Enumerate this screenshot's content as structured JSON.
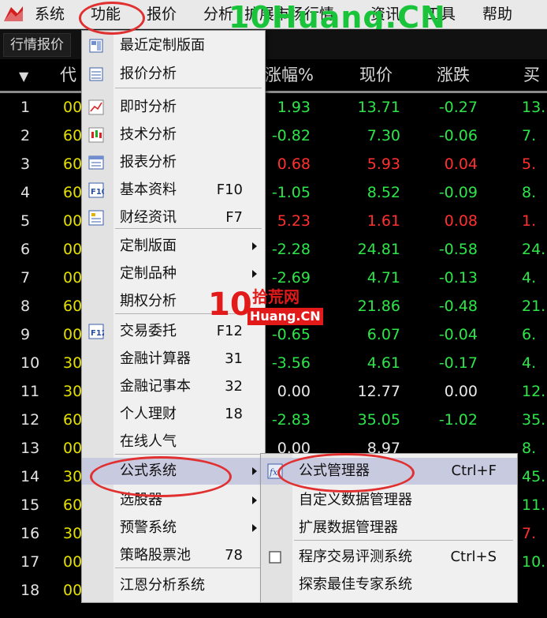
{
  "menubar": {
    "items": [
      "系统",
      "功能",
      "报价",
      "分析",
      "扩展市场行情",
      "资讯",
      "工具",
      "帮助"
    ],
    "watermark": "10Huang.CN"
  },
  "tab": {
    "label": "行情报价"
  },
  "header": {
    "sort_arrow": "▼",
    "code": "代",
    "pct": "涨幅%",
    "price": "现价",
    "chg": "涨跌",
    "buy": "买"
  },
  "rows": [
    {
      "n": "1",
      "code": "00",
      "pct": "1.93",
      "price": "13.71",
      "chg": "-0.27",
      "buy": "13.",
      "pc": "g",
      "prc": "g",
      "cc": "g",
      "bc": "g"
    },
    {
      "n": "2",
      "code": "60",
      "pct": "-0.82",
      "price": "7.30",
      "chg": "-0.06",
      "buy": "7.",
      "pc": "g",
      "prc": "g",
      "cc": "g",
      "bc": "g"
    },
    {
      "n": "3",
      "code": "60",
      "pct": "0.68",
      "price": "5.93",
      "chg": "0.04",
      "buy": "5.",
      "pc": "r",
      "prc": "r",
      "cc": "r",
      "bc": "r"
    },
    {
      "n": "4",
      "code": "60",
      "pct": "-1.05",
      "price": "8.52",
      "chg": "-0.09",
      "buy": "8.",
      "pc": "g",
      "prc": "g",
      "cc": "g",
      "bc": "g"
    },
    {
      "n": "5",
      "code": "00",
      "pct": "5.23",
      "price": "1.61",
      "chg": "0.08",
      "buy": "1.",
      "pc": "r",
      "prc": "r",
      "cc": "r",
      "bc": "r"
    },
    {
      "n": "6",
      "code": "00",
      "pct": "-2.28",
      "price": "24.81",
      "chg": "-0.58",
      "buy": "24.",
      "pc": "g",
      "prc": "g",
      "cc": "g",
      "bc": "g"
    },
    {
      "n": "7",
      "code": "00",
      "pct": "-2.69",
      "price": "4.71",
      "chg": "-0.13",
      "buy": "4.",
      "pc": "g",
      "prc": "g",
      "cc": "g",
      "bc": "g"
    },
    {
      "n": "8",
      "code": "60",
      "pct": "",
      "price": "21.86",
      "chg": "-0.48",
      "buy": "21.",
      "pc": "g",
      "prc": "g",
      "cc": "g",
      "bc": "g"
    },
    {
      "n": "9",
      "code": "00",
      "pct": "-0.65",
      "price": "6.07",
      "chg": "-0.04",
      "buy": "6.",
      "pc": "g",
      "prc": "g",
      "cc": "g",
      "bc": "g"
    },
    {
      "n": "10",
      "code": "30",
      "pct": "-3.56",
      "price": "4.61",
      "chg": "-0.17",
      "buy": "4.",
      "pc": "g",
      "prc": "g",
      "cc": "g",
      "bc": "g"
    },
    {
      "n": "11",
      "code": "30",
      "pct": "0.00",
      "price": "12.77",
      "chg": "0.00",
      "buy": "12.",
      "pc": "w",
      "prc": "w",
      "cc": "w",
      "bc": "g"
    },
    {
      "n": "12",
      "code": "60",
      "pct": "-2.83",
      "price": "35.05",
      "chg": "-1.02",
      "buy": "35.",
      "pc": "g",
      "prc": "g",
      "cc": "g",
      "bc": "g"
    },
    {
      "n": "13",
      "code": "00",
      "pct": "0.00",
      "price": "8.97",
      "chg": "",
      "buy": "8.",
      "pc": "w",
      "prc": "w",
      "cc": "w",
      "bc": "g"
    },
    {
      "n": "14",
      "code": "30",
      "pct": "",
      "price": "",
      "chg": "",
      "buy": "45.",
      "pc": "g",
      "prc": "g",
      "cc": "g",
      "bc": "g"
    },
    {
      "n": "15",
      "code": "60",
      "pct": "",
      "price": "",
      "chg": "",
      "buy": "11.",
      "pc": "g",
      "prc": "g",
      "cc": "g",
      "bc": "g"
    },
    {
      "n": "16",
      "code": "30",
      "pct": "",
      "price": "",
      "chg": "",
      "buy": "7.",
      "pc": "g",
      "prc": "g",
      "cc": "g",
      "bc": "r"
    },
    {
      "n": "17",
      "code": "00",
      "pct": "",
      "price": "",
      "chg": "",
      "buy": "10.",
      "pc": "g",
      "prc": "g",
      "cc": "g",
      "bc": "g"
    },
    {
      "n": "18",
      "code": "00",
      "pct": "",
      "price": "",
      "chg": "",
      "buy": "",
      "pc": "g",
      "prc": "g",
      "cc": "g",
      "bc": "g"
    }
  ],
  "menu": {
    "items": [
      {
        "label": "最近定制版面",
        "icon": "layout-icon",
        "shortcut": ""
      },
      {
        "label": "报价分析",
        "icon": "quote-icon",
        "shortcut": ""
      },
      {
        "label": "即时分析",
        "icon": "line-chart-icon",
        "shortcut": ""
      },
      {
        "label": "技术分析",
        "icon": "candlestick-icon",
        "shortcut": ""
      },
      {
        "label": "报表分析",
        "icon": "report-icon",
        "shortcut": ""
      },
      {
        "label": "基本资料",
        "icon": "f10-icon",
        "shortcut": "F10"
      },
      {
        "label": "财经资讯",
        "icon": "news-icon",
        "shortcut": "F7"
      },
      {
        "label": "定制版面",
        "icon": "",
        "shortcut": ""
      },
      {
        "label": "定制品种",
        "icon": "",
        "shortcut": ""
      },
      {
        "label": "期权分析",
        "icon": "",
        "shortcut": ""
      },
      {
        "label": "交易委托",
        "icon": "f12-icon",
        "shortcut": "F12"
      },
      {
        "label": "金融计算器",
        "icon": "",
        "shortcut": "31"
      },
      {
        "label": "金融记事本",
        "icon": "",
        "shortcut": "32"
      },
      {
        "label": "个人理财",
        "icon": "",
        "shortcut": "18"
      },
      {
        "label": "在线人气",
        "icon": "",
        "shortcut": ""
      },
      {
        "label": "公式系统",
        "icon": "",
        "shortcut": ""
      },
      {
        "label": "选股器",
        "icon": "",
        "shortcut": ""
      },
      {
        "label": "预警系统",
        "icon": "",
        "shortcut": ""
      },
      {
        "label": "策略股票池",
        "icon": "",
        "shortcut": "78"
      },
      {
        "label": "江恩分析系统",
        "icon": "",
        "shortcut": ""
      }
    ]
  },
  "submenu": {
    "items": [
      {
        "label": "公式管理器",
        "shortcut": "Ctrl+F",
        "icon": "formula-icon"
      },
      {
        "label": "自定义数据管理器",
        "shortcut": "",
        "icon": ""
      },
      {
        "label": "扩展数据管理器",
        "shortcut": "",
        "icon": ""
      },
      {
        "label": "程序交易评测系统",
        "shortcut": "Ctrl+S",
        "icon": "checkbox-icon"
      },
      {
        "label": "探索最佳专家系统",
        "shortcut": "",
        "icon": ""
      }
    ]
  },
  "watermark2": {
    "digits": "10",
    "cn": "拾荒网",
    "site": "Huang.CN"
  },
  "colors": {
    "up": "#ff3030",
    "down": "#2ee54a",
    "flat": "#e8e8e8",
    "code": "#e3e000",
    "highlight": "#c8cae0",
    "annotation": "#e03030"
  }
}
